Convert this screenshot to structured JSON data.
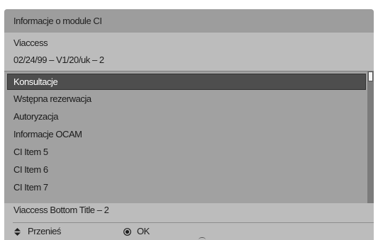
{
  "dialog": {
    "title": "Informacje o module CI",
    "info_line1": "Viaccess",
    "info_line2": "02/24/99 – V1/20/uk – 2",
    "menu_items": [
      {
        "label": "Konsultacje",
        "selected": true
      },
      {
        "label": "Wstępna rezerwacja",
        "selected": false
      },
      {
        "label": "Autoryzacja",
        "selected": false
      },
      {
        "label": "Informacje OCAM",
        "selected": false
      },
      {
        "label": "CI Item 5",
        "selected": false
      },
      {
        "label": "CI Item 6",
        "selected": false
      },
      {
        "label": "CI Item 7",
        "selected": false
      }
    ],
    "bottom_title": "Viaccess Bottom Title – 2"
  },
  "legend": {
    "move_label": "Przenieś",
    "move_icon": "up-down-arrows-icon",
    "ok_label": "OK",
    "ok_icon": "ok-button-icon"
  },
  "colors": {
    "panel_bg": "#bcbcbc",
    "title_bg": "#9d9d9d",
    "list_bg": "#a1a1a1",
    "selection_bg": "#4e4e4e",
    "scrollbar_track": "#7b7b7b"
  }
}
